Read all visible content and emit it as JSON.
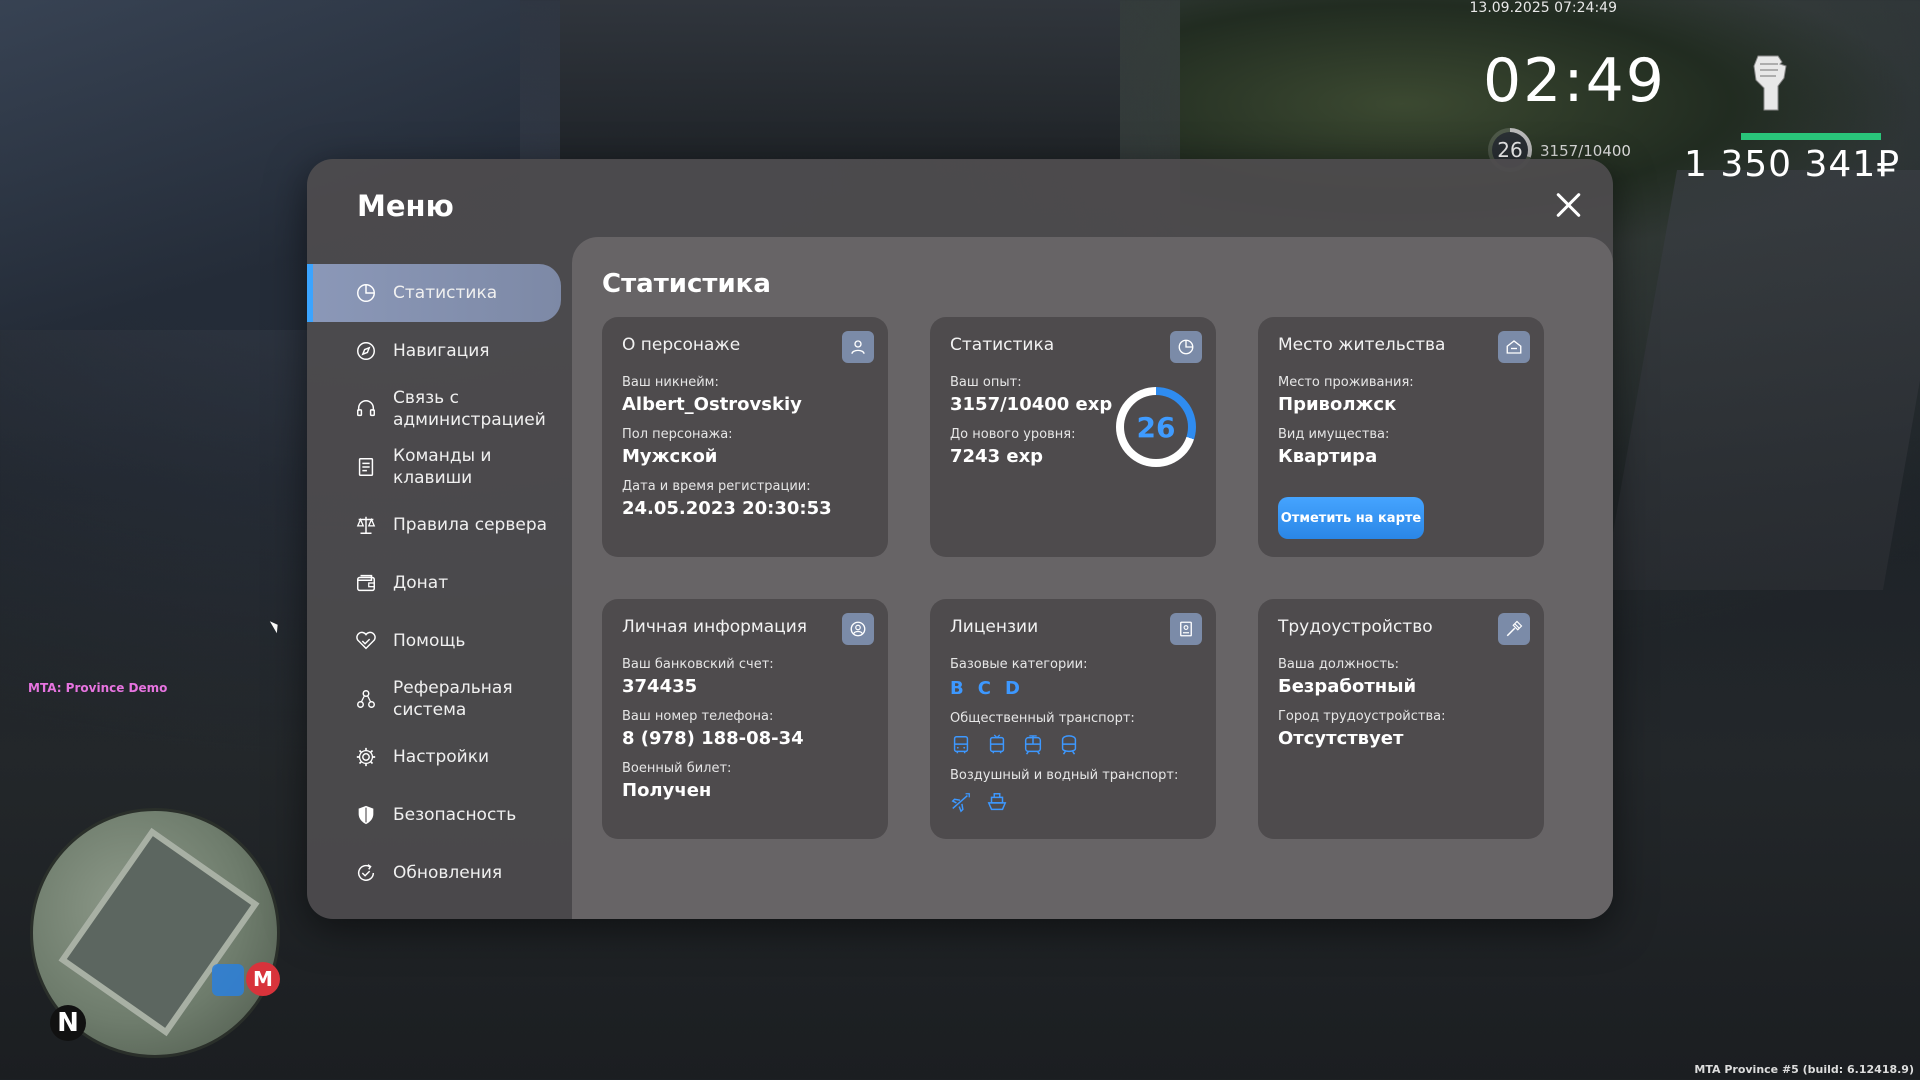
{
  "hud": {
    "datetime": "13.09.2025 07:24:49",
    "clock": "02:49",
    "level": "26",
    "exp": "3157/10400",
    "money": "1 350 341₽",
    "health_fraction": 1.0
  },
  "mta_label": "MTA: Province Demo",
  "build_label": "MTA Province #5 (build: 6.12418.9)",
  "minimap": {
    "north_label": "N",
    "marker_label": "M"
  },
  "menu": {
    "title": "Меню",
    "sidebar": {
      "items": [
        {
          "label": "Статистика",
          "icon": "pie-chart-icon",
          "active": true
        },
        {
          "label": "Навигация",
          "icon": "compass-icon"
        },
        {
          "label": "Связь с\nадминистрацией",
          "icon": "headset-icon"
        },
        {
          "label": "Команды и\nклавиши",
          "icon": "document-icon"
        },
        {
          "label": "Правила сервера",
          "icon": "scales-icon"
        },
        {
          "label": "Донат",
          "icon": "wallet-icon"
        },
        {
          "label": "Помощь",
          "icon": "handshake-icon"
        },
        {
          "label": "Реферальная\nсистема",
          "icon": "people-network-icon"
        },
        {
          "label": "Настройки",
          "icon": "gear-icon"
        },
        {
          "label": "Безопасность",
          "icon": "shield-icon"
        },
        {
          "label": "Обновления",
          "icon": "update-check-icon"
        }
      ]
    },
    "content": {
      "title": "Статистика",
      "character": {
        "title": "О персонаже",
        "nickname_label": "Ваш никнейм:",
        "nickname": "Albert_Ostrovskiy",
        "gender_label": "Пол персонажа:",
        "gender": "Мужской",
        "reg_label": "Дата и время регистрации:",
        "reg_date": "24.05.2023 20:30:53"
      },
      "stats": {
        "title": "Статистика",
        "exp_label": "Ваш опыт:",
        "exp": "3157/10400 exp",
        "next_label": "До нового уровня:",
        "next": "7243 exp",
        "level": "26",
        "progress_fraction": 0.3
      },
      "residence": {
        "title": "Место жительства",
        "place_label": "Место проживания:",
        "place": "Приволжск",
        "property_label": "Вид имущества:",
        "property": "Квартира",
        "map_button": "Отметить на карте"
      },
      "personal": {
        "title": "Личная информация",
        "bank_label": "Ваш банковский счет:",
        "bank": "374435",
        "phone_label": "Ваш номер телефона:",
        "phone": "8 (978) 188-08-34",
        "military_label": "Военный билет:",
        "military": "Получен"
      },
      "licenses": {
        "title": "Лицензии",
        "base_label": "Базовые категории:",
        "base_categories": [
          "B",
          "C",
          "D"
        ],
        "public_label": "Общественный транспорт:",
        "public_icons": [
          "bus-icon",
          "trolleybus-icon",
          "tram-icon",
          "metro-icon"
        ],
        "air_water_label": "Воздушный и водный транспорт:",
        "air_water_icons": [
          "airplane-icon",
          "boat-icon"
        ]
      },
      "employment": {
        "title": "Трудоустройство",
        "position_label": "Ваша должность:",
        "position": "Безработный",
        "city_label": "Город трудоустройства:",
        "city": "Отсутствует"
      }
    }
  },
  "colors": {
    "accent": "#3ba4ff",
    "health": "#29c57a",
    "panel": "#4e4b4d",
    "content_bg": "#676466"
  }
}
